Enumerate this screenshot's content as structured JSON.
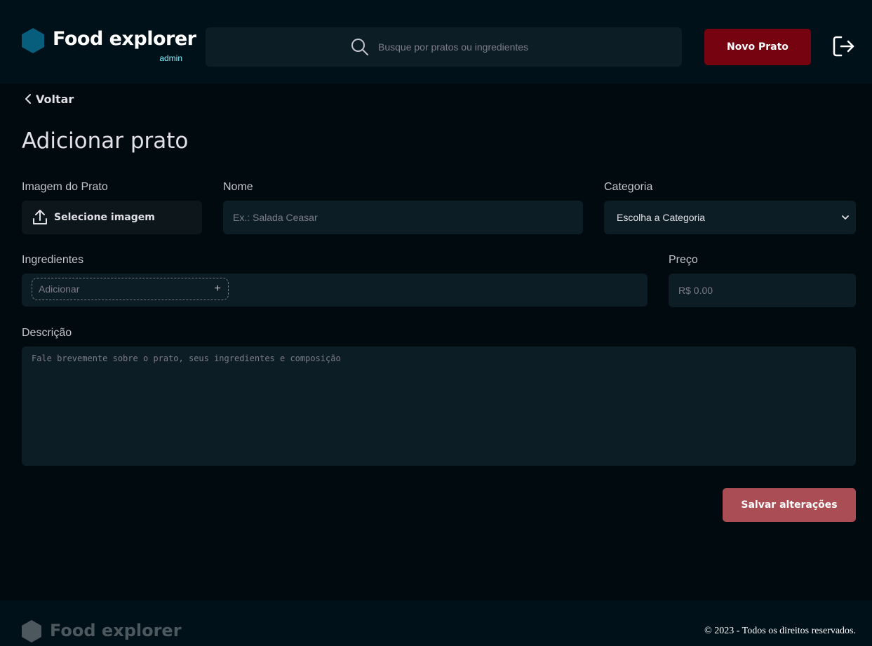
{
  "header": {
    "logo_title": "Food explorer",
    "logo_subtitle": "admin",
    "search_placeholder": "Busque por pratos ou ingredientes",
    "new_dish_label": "Novo Prato"
  },
  "nav": {
    "back_label": "Voltar"
  },
  "form": {
    "title": "Adicionar prato",
    "image": {
      "label": "Imagem do Prato",
      "button_label": "Selecione imagem"
    },
    "name": {
      "label": "Nome",
      "placeholder": "Ex.: Salada Ceasar",
      "value": ""
    },
    "category": {
      "label": "Categoria",
      "selected": "Escolha a Categoria"
    },
    "ingredients": {
      "label": "Ingredientes",
      "add_placeholder": "Adicionar",
      "add_symbol": "+"
    },
    "price": {
      "label": "Preço",
      "placeholder": "R$ 0.00",
      "value": ""
    },
    "description": {
      "label": "Descrição",
      "placeholder": "Fale brevemente sobre o prato, seus ingredientes e composição",
      "value": ""
    },
    "save_label": "Salvar alterações"
  },
  "footer": {
    "logo_title": "Food explorer",
    "copyright": "© 2023 - Todos os direitos reservados."
  },
  "colors": {
    "brand_hex": "#065E7C",
    "primary_button": "#750310",
    "save_button": "#AB4D55",
    "admin_accent": "#82F3FF"
  }
}
